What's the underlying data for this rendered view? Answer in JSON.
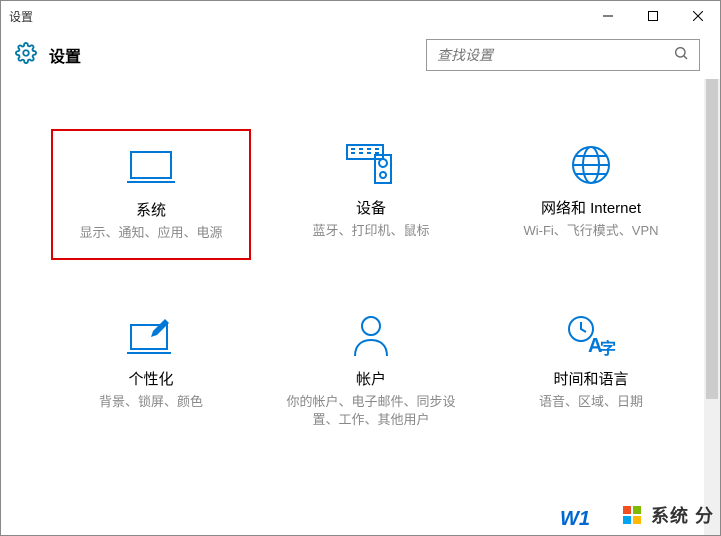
{
  "window": {
    "title": "设置"
  },
  "header": {
    "title": "设置",
    "search_placeholder": "查找设置"
  },
  "tiles": {
    "system": {
      "title": "系统",
      "desc": "显示、通知、应用、电源"
    },
    "devices": {
      "title": "设备",
      "desc": "蓝牙、打印机、鼠标"
    },
    "network": {
      "title": "网络和 Internet",
      "desc": "Wi-Fi、飞行模式、VPN"
    },
    "personalization": {
      "title": "个性化",
      "desc": "背景、锁屏、颜色"
    },
    "accounts": {
      "title": "帐户",
      "desc": "你的帐户、电子邮件、同步设置、工作、其他用户"
    },
    "time": {
      "title": "时间和语言",
      "desc": "语音、区域、日期"
    }
  },
  "watermark": {
    "partial": "W1",
    "text": "系统  分"
  }
}
